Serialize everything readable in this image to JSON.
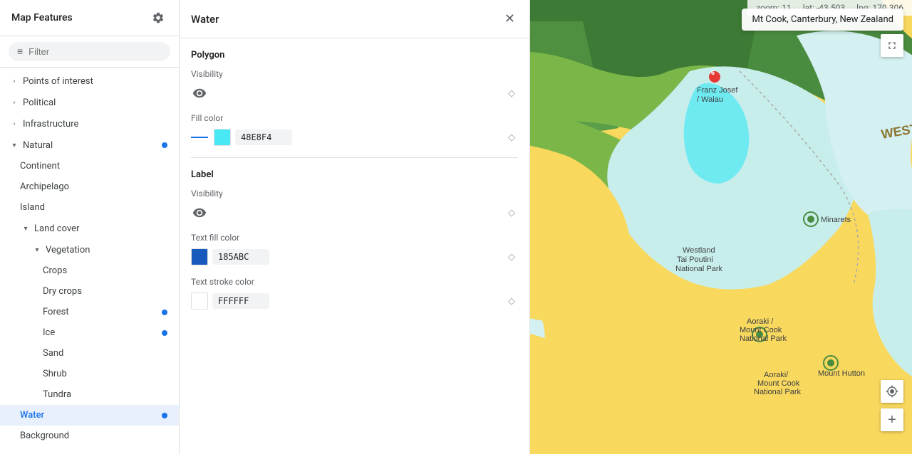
{
  "sidebar": {
    "title": "Map Features",
    "filter_placeholder": "Filter",
    "items": [
      {
        "id": "points-of-interest",
        "label": "Points of interest",
        "indent": 1,
        "caret": "›",
        "has_caret": true,
        "dot": false
      },
      {
        "id": "political",
        "label": "Political",
        "indent": 1,
        "caret": "›",
        "has_caret": true,
        "dot": false
      },
      {
        "id": "infrastructure",
        "label": "Infrastructure",
        "indent": 1,
        "caret": "›",
        "has_caret": true,
        "dot": false
      },
      {
        "id": "natural",
        "label": "Natural",
        "indent": 1,
        "caret": "▾",
        "has_caret": true,
        "dot": true
      },
      {
        "id": "continent",
        "label": "Continent",
        "indent": 2,
        "has_caret": false,
        "dot": false
      },
      {
        "id": "archipelago",
        "label": "Archipelago",
        "indent": 2,
        "has_caret": false,
        "dot": false
      },
      {
        "id": "island",
        "label": "Island",
        "indent": 2,
        "has_caret": false,
        "dot": false
      },
      {
        "id": "land-cover",
        "label": "Land cover",
        "indent": 2,
        "caret": "▾",
        "has_caret": true,
        "dot": false
      },
      {
        "id": "vegetation",
        "label": "Vegetation",
        "indent": 3,
        "caret": "▾",
        "has_caret": true,
        "dot": false
      },
      {
        "id": "crops",
        "label": "Crops",
        "indent": 4,
        "has_caret": false,
        "dot": false
      },
      {
        "id": "dry-crops",
        "label": "Dry crops",
        "indent": 4,
        "has_caret": false,
        "dot": false
      },
      {
        "id": "forest",
        "label": "Forest",
        "indent": 4,
        "has_caret": false,
        "dot": true
      },
      {
        "id": "ice",
        "label": "Ice",
        "indent": 4,
        "has_caret": false,
        "dot": true
      },
      {
        "id": "sand",
        "label": "Sand",
        "indent": 4,
        "has_caret": false,
        "dot": false
      },
      {
        "id": "shrub",
        "label": "Shrub",
        "indent": 4,
        "has_caret": false,
        "dot": false
      },
      {
        "id": "tundra",
        "label": "Tundra",
        "indent": 4,
        "has_caret": false,
        "dot": false
      },
      {
        "id": "water",
        "label": "Water",
        "indent": 2,
        "has_caret": false,
        "dot": true,
        "active": true
      },
      {
        "id": "background",
        "label": "Background",
        "indent": 2,
        "has_caret": false,
        "dot": false
      }
    ]
  },
  "panel": {
    "title": "Water",
    "polygon_label": "Polygon",
    "visibility_label": "Visibility",
    "fill_color_label": "Fill color",
    "fill_color_hex": "48E8F4",
    "label_section": "Label",
    "label_visibility_label": "Visibility",
    "text_fill_color_label": "Text fill color",
    "text_fill_color_hex": "185ABC",
    "text_stroke_color_label": "Text stroke color",
    "text_stroke_color_hex": "FFFFFF"
  },
  "map": {
    "location_label": "Mt Cook, Canterbury, New Zealand",
    "zoom_label": "zoom:",
    "zoom_value": "11",
    "lat_label": "lat:",
    "lat_value": "-43.503",
    "lng_label": "lng:",
    "lng_value": "170.306"
  },
  "colors": {
    "water_fill": "#48E8F4",
    "text_fill": "#185ABC",
    "text_stroke": "#FFFFFF"
  }
}
